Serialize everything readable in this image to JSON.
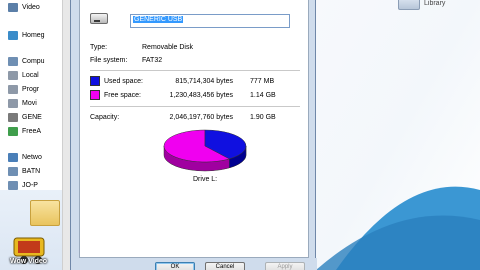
{
  "explorer": {
    "nav": [
      {
        "label": "Video",
        "icon": "video-library-icon",
        "color": "#5b7fa8"
      },
      {
        "label": "Homeg",
        "icon": "homegroup-icon",
        "color": "#3a8cc9"
      },
      {
        "label": "Compu",
        "icon": "computer-icon",
        "color": "#6f8fb3"
      },
      {
        "label": "Local",
        "icon": "local-disk-icon",
        "color": "#8e99a8"
      },
      {
        "label": "Progr",
        "icon": "drive-icon",
        "color": "#8e99a8"
      },
      {
        "label": "Movi",
        "icon": "drive-icon",
        "color": "#8e99a8"
      },
      {
        "label": "GENE",
        "icon": "usb-drive-icon",
        "color": "#7a7a7a"
      },
      {
        "label": "FreeA",
        "icon": "network-drive-icon",
        "color": "#3f9e4c"
      },
      {
        "label": "Netwo",
        "icon": "network-icon",
        "color": "#4a7fb8"
      },
      {
        "label": "BATN",
        "icon": "network-computer-icon",
        "color": "#6f8fb3"
      },
      {
        "label": "JO-P",
        "icon": "network-computer-icon",
        "color": "#6f8fb3"
      }
    ],
    "watermark": "Wow Video"
  },
  "library": {
    "label": "Library"
  },
  "dialog": {
    "name_value": "GENERIC USB",
    "type_label": "Type:",
    "type_value": "Removable Disk",
    "fs_label": "File system:",
    "fs_value": "FAT32",
    "used": {
      "label": "Used space:",
      "bytes": "815,714,304 bytes",
      "size": "777 MB",
      "color": "#1010e0"
    },
    "free": {
      "label": "Free space:",
      "bytes": "1,230,483,456 bytes",
      "size": "1.14 GB",
      "color": "#f000f0"
    },
    "capacity": {
      "label": "Capacity:",
      "bytes": "2,046,197,760 bytes",
      "size": "1.90 GB"
    },
    "used_fraction": 0.3987,
    "drive_label": "Drive L:",
    "buttons": {
      "ok": "OK",
      "cancel": "Cancel",
      "apply": "Apply"
    }
  }
}
